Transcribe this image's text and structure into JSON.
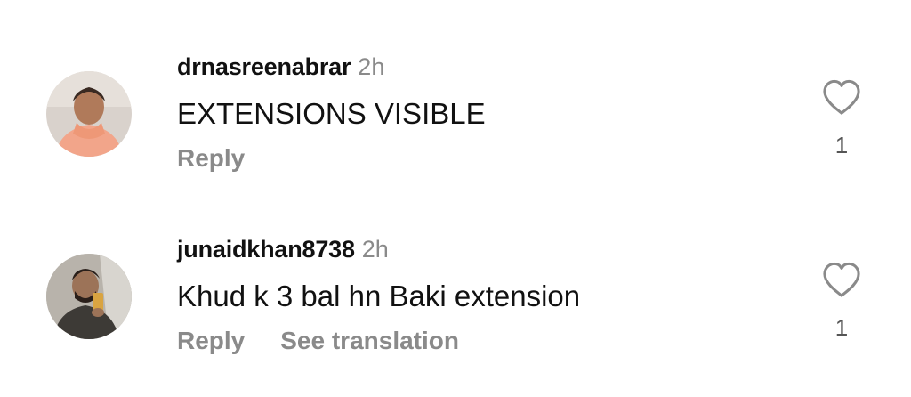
{
  "comments": [
    {
      "username": "drnasreenabrar",
      "time": "2h",
      "text": "EXTENSIONS VISIBLE",
      "reply_label": "Reply",
      "like_count": "1",
      "avatar": "woman-in-peach-scarf"
    },
    {
      "username": "junaidkhan8738",
      "time": "2h",
      "text": "Khud k 3 bal hn Baki extension",
      "reply_label": "Reply",
      "translate_label": "See translation",
      "like_count": "1",
      "avatar": "man-taking-mirror-selfie"
    }
  ],
  "icons": {
    "like": "heart-outline-icon"
  },
  "colors": {
    "username": "#111111",
    "meta_gray": "#8a8a8a",
    "like_count": "#555555"
  }
}
